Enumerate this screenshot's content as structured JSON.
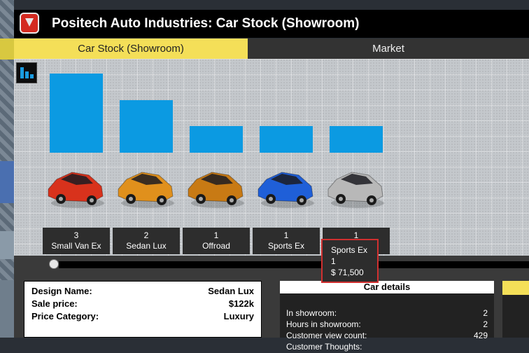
{
  "window": {
    "title": "Positech Auto Industries: Car Stock (Showroom)"
  },
  "tabs": [
    {
      "label": "Car Stock (Showroom)",
      "active": true
    },
    {
      "label": "Market",
      "active": false
    }
  ],
  "chart_data": {
    "type": "bar",
    "categories": [
      "Small Van Ex",
      "Sedan Lux",
      "Offroad",
      "Sports Ex",
      ""
    ],
    "values": [
      3,
      2,
      1,
      1,
      1
    ],
    "ylim": [
      0,
      3
    ],
    "bar_color": "#0b9ae2",
    "car_colors": [
      "#d8321c",
      "#e0901c",
      "#c87a14",
      "#1f5fd8",
      "#b8b8b8"
    ],
    "labels": [
      {
        "count": "3",
        "name": "Small Van Ex"
      },
      {
        "count": "2",
        "name": "Sedan Lux"
      },
      {
        "count": "1",
        "name": "Offroad"
      },
      {
        "count": "1",
        "name": "Sports Ex"
      },
      {
        "count": "1",
        "name": ""
      }
    ]
  },
  "tooltip": {
    "name": "Sports Ex",
    "count": "1",
    "price": "$ 71,500"
  },
  "design_info": {
    "rows": [
      {
        "label": "Design Name:",
        "value": "Sedan Lux"
      },
      {
        "label": "Sale price:",
        "value": "$122k"
      },
      {
        "label": "Price Category:",
        "value": "Luxury"
      }
    ]
  },
  "car_details": {
    "title": "Car details",
    "rows": [
      {
        "label": "In showroom:",
        "value": "2"
      },
      {
        "label": "Hours in showroom:",
        "value": "2"
      },
      {
        "label": "Customer view count:",
        "value": "429"
      },
      {
        "label": "Customer Thoughts:",
        "value": ""
      }
    ]
  },
  "colors": {
    "accent": "#f4df58",
    "tooltip_border": "#d03030"
  }
}
